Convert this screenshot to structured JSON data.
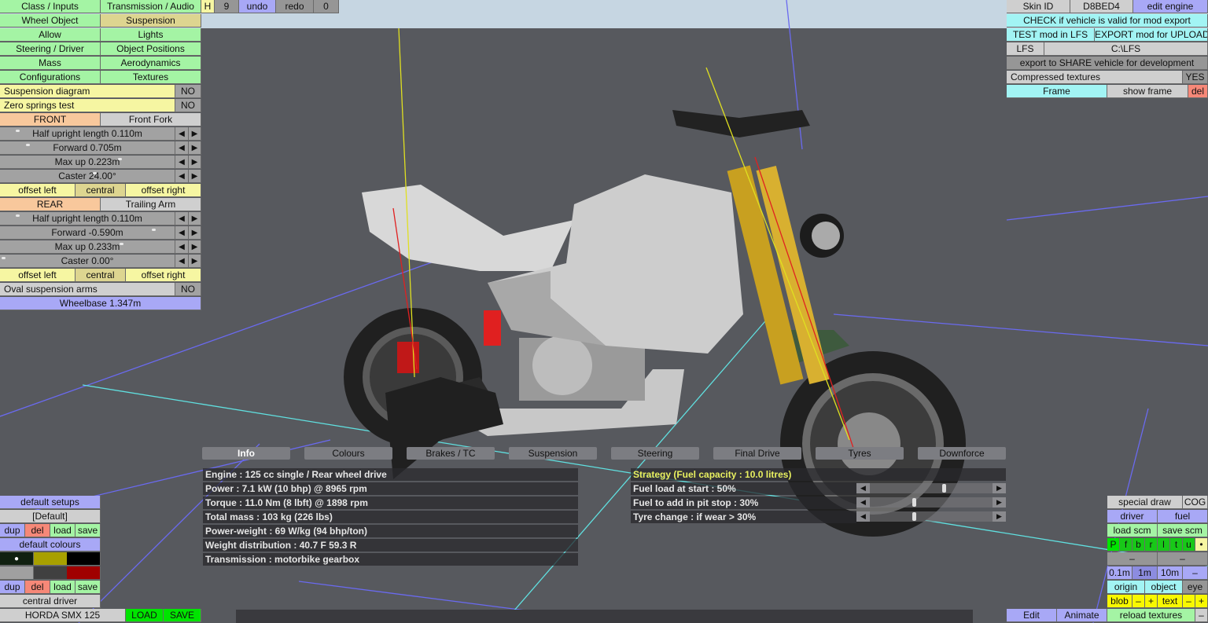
{
  "top_left_menu": {
    "class_inputs": "Class / Inputs",
    "transmission_audio": "Transmission / Audio",
    "h": "H",
    "nine": "9",
    "undo": "undo",
    "redo": "redo",
    "zero": "0",
    "wheel_object": "Wheel Object",
    "suspension": "Suspension",
    "allow": "Allow",
    "lights": "Lights",
    "steering_driver": "Steering / Driver",
    "object_positions": "Object Positions",
    "mass": "Mass",
    "aerodynamics": "Aerodynamics",
    "configurations": "Configurations",
    "textures": "Textures"
  },
  "suspension_panel": {
    "suspension_diagram": {
      "label": "Suspension diagram",
      "value": "NO"
    },
    "zero_springs": {
      "label": "Zero springs test",
      "value": "NO"
    },
    "front": {
      "label": "FRONT",
      "type": "Front Fork",
      "half_upright": "Half upright length 0.110m",
      "forward": "Forward 0.705m",
      "max_up": "Max up 0.223m",
      "caster": "Caster 24.00°",
      "offset_left": "offset left",
      "central": "central",
      "offset_right": "offset right"
    },
    "rear": {
      "label": "REAR",
      "type": "Trailing Arm",
      "half_upright": "Half upright length 0.110m",
      "forward": "Forward -0.590m",
      "max_up": "Max up 0.233m",
      "caster": "Caster 0.00°",
      "offset_left": "offset left",
      "central": "central",
      "offset_right": "offset right"
    },
    "oval_arms": {
      "label": "Oval suspension arms",
      "value": "NO"
    },
    "wheelbase": "Wheelbase 1.347m",
    "arrow_left": "◀",
    "arrow_right": "▶"
  },
  "top_right": {
    "skin_id_label": "Skin ID",
    "skin_id": "D8BED4",
    "edit_engine": "edit engine",
    "check": "CHECK if vehicle is valid for mod export",
    "test": "TEST mod in LFS",
    "export": "EXPORT mod for UPLOAD",
    "lfs": "LFS",
    "lfs_path": "C:\\LFS",
    "share": "export to SHARE vehicle for development",
    "compressed": "Compressed textures",
    "compressed_value": "YES",
    "frame": "Frame",
    "show_frame": "show frame",
    "del": "del"
  },
  "bottom_left": {
    "default_setups": "default setups",
    "setup_name": "[Default]",
    "dup": "dup",
    "del": "del",
    "load": "load",
    "save": "save",
    "default_colours": "default colours",
    "central_driver": "central driver",
    "vehicle_name": "HORDA SMX 125",
    "load_btn": "LOAD",
    "save_btn": "SAVE",
    "colours": [
      "#102010",
      "#a8a000",
      "#000000",
      "#a0a0a0",
      "#404040",
      "#a00000"
    ],
    "selected_marker": "●"
  },
  "bottom_right": {
    "special_draw": "special draw",
    "cog": "COG",
    "driver": "driver",
    "fuel": "fuel",
    "load_scm": "load scm",
    "save_scm": "save scm",
    "letters": [
      "P",
      "f",
      "b",
      "r",
      "l",
      "t",
      "u",
      "•"
    ],
    "dash": "–",
    "m01": "0.1m",
    "m1": "1m",
    "m10": "10m",
    "origin": "origin",
    "object": "object",
    "eye": "eye",
    "blob": "blob",
    "minus": "–",
    "plus": "+",
    "text": "text",
    "edit": "Edit",
    "animate": "Animate",
    "reload_textures": "reload textures"
  },
  "tabs": [
    "Info",
    "Colours",
    "Brakes / TC",
    "Suspension",
    "Steering",
    "Final Drive",
    "Tyres",
    "Downforce"
  ],
  "active_tab": "Info",
  "info": [
    "Engine : 125 cc single / Rear wheel drive",
    "Power : 7.1 kW (10 bhp) @ 8965 rpm",
    "Torque : 11.0 Nm (8 lbft) @ 1898 rpm",
    "Total mass : 103 kg (226 lbs)",
    "Power-weight : 69 W/kg (94 bhp/ton)",
    "Weight distribution : 40.7 F  59.3 R",
    "Transmission : motorbike gearbox"
  ],
  "strategy": {
    "title": "Strategy (Fuel capacity : 10.0 litres)",
    "title_color": "#e8f060",
    "rows": [
      {
        "label": "Fuel load at start : 50%",
        "value": 50
      },
      {
        "label": "Fuel to add in pit stop : 30%",
        "value": 30
      },
      {
        "label": "Tyre change : if wear > 30%",
        "value": 30
      }
    ]
  }
}
